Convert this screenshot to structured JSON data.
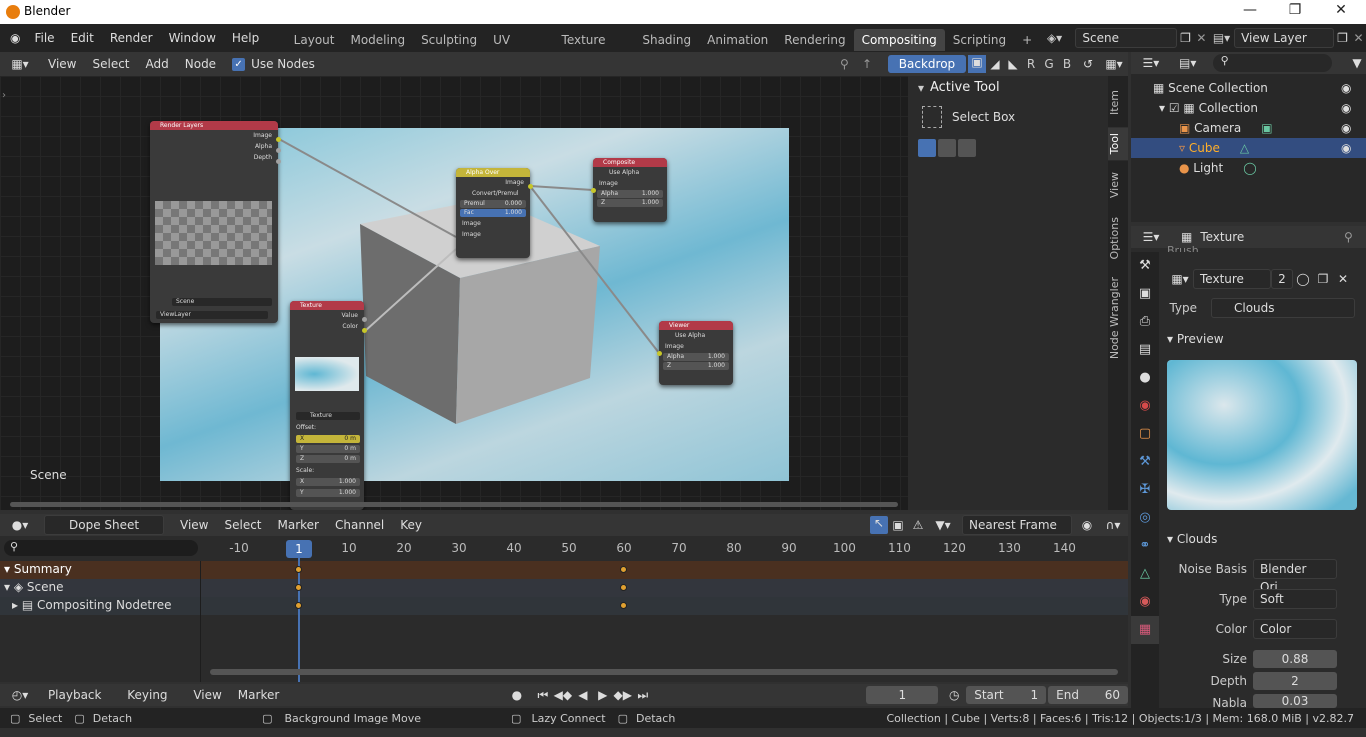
{
  "window": {
    "title": "Blender"
  },
  "menu": [
    "File",
    "Edit",
    "Render",
    "Window",
    "Help"
  ],
  "workspaces": [
    "Layout",
    "Modeling",
    "Sculpting",
    "UV Editing",
    "Texture Paint",
    "Shading",
    "Animation",
    "Rendering",
    "Compositing",
    "Scripting"
  ],
  "active_workspace": "Compositing",
  "scene_field": "Scene",
  "viewlayer_field": "View Layer",
  "node_header": {
    "view": "View",
    "select": "Select",
    "add": "Add",
    "node": "Node",
    "use_nodes": "Use Nodes",
    "backdrop": "Backdrop",
    "channels": [
      "R",
      "G",
      "B"
    ]
  },
  "node_editor": {
    "scene_label": "Scene"
  },
  "nodes": {
    "render_layers": {
      "title": "Render Layers",
      "outputs": [
        "Image",
        "Alpha",
        "Depth"
      ],
      "scene": "Scene",
      "layer": "ViewLayer"
    },
    "alpha_over": {
      "title": "Alpha Over",
      "output": "Image",
      "convert": "Convert/Premul",
      "premul_label": "Premul",
      "premul_value": "0.000",
      "fac_label": "Fac",
      "fac_value": "1.000",
      "in1": "Image",
      "in2": "Image"
    },
    "composite": {
      "title": "Composite",
      "use_alpha": "Use Alpha",
      "input": "Image",
      "alpha_label": "Alpha",
      "alpha_value": "1.000",
      "z_label": "Z",
      "z_value": "1.000"
    },
    "viewer": {
      "title": "Viewer",
      "use_alpha": "Use Alpha",
      "input": "Image",
      "alpha_label": "Alpha",
      "alpha_value": "1.000",
      "z_label": "Z",
      "z_value": "1.000"
    },
    "texture": {
      "title": "Texture",
      "outputs": [
        "Value",
        "Color"
      ],
      "tex_name": "Texture",
      "offset": "Offset:",
      "ox": "X",
      "oxv": "0 m",
      "oy": "Y",
      "oyv": "0 m",
      "oz": "Z",
      "ozv": "0 m",
      "scale": "Scale:",
      "sx": "X",
      "sxv": "1.000",
      "sy": "Y",
      "syv": "1.000"
    }
  },
  "sidebar": {
    "title": "Active Tool",
    "tool": "Select Box",
    "tabs": [
      "Item",
      "Tool",
      "View",
      "Options",
      "Node Wrangler"
    ],
    "active_tab": "Tool"
  },
  "outliner": {
    "root": "Scene Collection",
    "items": [
      {
        "name": "Collection",
        "indent": 1
      },
      {
        "name": "Camera",
        "indent": 2
      },
      {
        "name": "Cube",
        "indent": 2,
        "selected": true
      },
      {
        "name": "Light",
        "indent": 2
      }
    ]
  },
  "properties": {
    "context": "Texture",
    "partial": "Brush",
    "tex_name": "Texture",
    "users": "2",
    "type_label": "Type",
    "type_value": "Clouds",
    "preview_label": "Preview",
    "clouds_label": "Clouds",
    "fields": [
      {
        "label": "Noise Basis",
        "value": "Blender Ori...",
        "kind": "drop"
      },
      {
        "label": "Type",
        "value": "Soft",
        "kind": "drop"
      },
      {
        "label": "Color",
        "value": "Color",
        "kind": "drop"
      },
      {
        "label": "Size",
        "value": "0.88",
        "kind": "num"
      },
      {
        "label": "Depth",
        "value": "2",
        "kind": "num"
      },
      {
        "label": "Nabla",
        "value": "0.03",
        "kind": "num"
      }
    ]
  },
  "dopesheet": {
    "mode": "Dope Sheet",
    "view": "View",
    "select": "Select",
    "marker": "Marker",
    "channel": "Channel",
    "key": "Key",
    "snap": "Nearest Frame",
    "ruler": [
      "-10",
      "1",
      "10",
      "20",
      "30",
      "40",
      "50",
      "60",
      "70",
      "80",
      "90",
      "100",
      "110",
      "120",
      "130",
      "140"
    ],
    "current_frame": "1",
    "channels": [
      "Summary",
      "Scene",
      "Compositing Nodetree"
    ]
  },
  "playback": {
    "playback": "Playback",
    "keying": "Keying",
    "view": "View",
    "marker": "Marker",
    "frame": "1",
    "start_label": "Start",
    "start": "1",
    "end_label": "End",
    "end": "60"
  },
  "status": {
    "select": "Select",
    "detach": "Detach",
    "bg_move": "Background Image Move",
    "lazy": "Lazy Connect",
    "detach2": "Detach",
    "info": "Collection | Cube | Verts:8 | Faces:6 | Tris:12 | Objects:1/3 | Mem: 168.0 MiB | v2.82.7"
  },
  "colors": {
    "accent": "#4772b3",
    "orange": "#e0a030",
    "node_red": "#b23a48",
    "node_yellow": "#c4b53a"
  }
}
